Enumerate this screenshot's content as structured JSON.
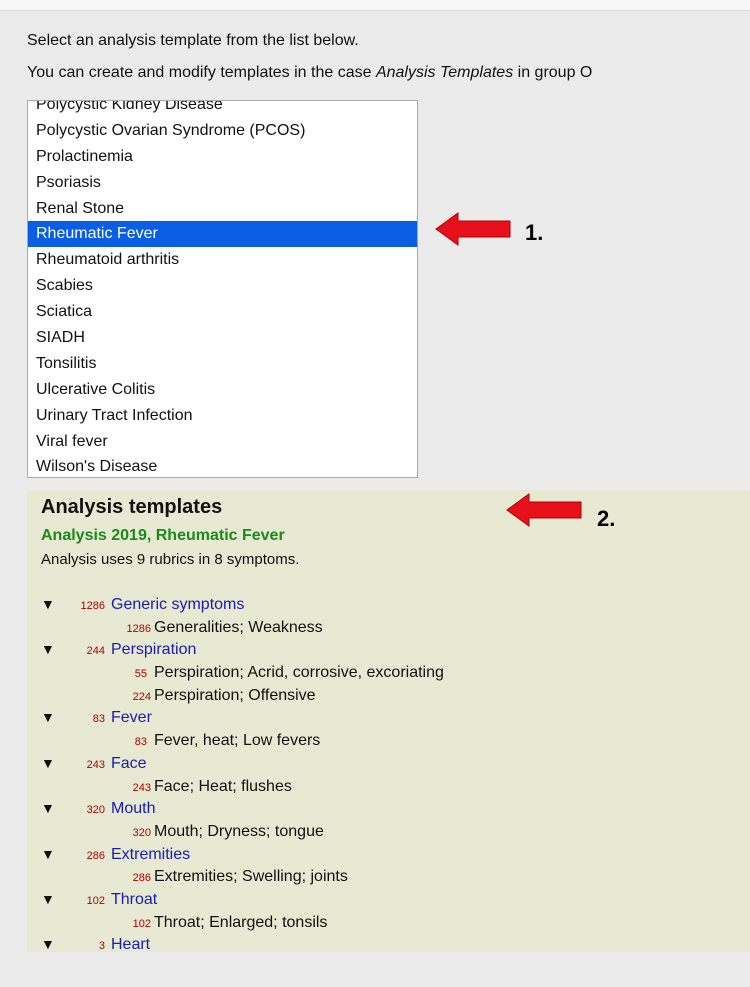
{
  "intro": {
    "line1": "Select an analysis template from the list below.",
    "line2_prefix": "You can create and modify templates in the case ",
    "line2_case": "Analysis Templates",
    "line2_suffix": " in group O"
  },
  "template_list": {
    "items": [
      "Polycystic Kidney Disease",
      "Polycystic Ovarian Syndrome (PCOS)",
      "Prolactinemia",
      "Psoriasis",
      "Renal Stone",
      "Rheumatic Fever",
      "Rheumatoid arthritis",
      "Scabies",
      "Sciatica",
      "SIADH",
      "Tonsilitis",
      "Ulcerative Colitis",
      "Urinary Tract Infection",
      "Viral fever",
      "Wilson's Disease"
    ],
    "selected": "Rheumatic Fever"
  },
  "annotations": {
    "label1": "1.",
    "label2": "2.",
    "arrow_color": "#e8101a"
  },
  "panel": {
    "title": "Analysis templates",
    "subtitle": "Analysis 2019, Rheumatic Fever",
    "description": "Analysis uses 9 rubrics in 8 symptoms.",
    "groups": [
      {
        "count": "1286",
        "label": "Generic symptoms",
        "rubrics": [
          {
            "count": "1286",
            "label": "Generalities; Weakness"
          }
        ]
      },
      {
        "count": "244",
        "label": "Perspiration",
        "rubrics": [
          {
            "count": "55",
            "label": "Perspiration; Acrid, corrosive, excoriating"
          },
          {
            "count": "224",
            "label": "Perspiration; Offensive"
          }
        ]
      },
      {
        "count": "83",
        "label": "Fever",
        "rubrics": [
          {
            "count": "83",
            "label": "Fever, heat; Low fevers"
          }
        ]
      },
      {
        "count": "243",
        "label": "Face",
        "rubrics": [
          {
            "count": "243",
            "label": "Face; Heat; flushes"
          }
        ]
      },
      {
        "count": "320",
        "label": "Mouth",
        "rubrics": [
          {
            "count": "320",
            "label": "Mouth; Dryness; tongue"
          }
        ]
      },
      {
        "count": "286",
        "label": "Extremities",
        "rubrics": [
          {
            "count": "286",
            "label": "Extremities; Swelling; joints"
          }
        ]
      },
      {
        "count": "102",
        "label": "Throat",
        "rubrics": [
          {
            "count": "102",
            "label": "Throat; Enlarged; tonsils"
          }
        ]
      },
      {
        "count": "3",
        "label": "Heart",
        "rubrics": []
      }
    ]
  }
}
